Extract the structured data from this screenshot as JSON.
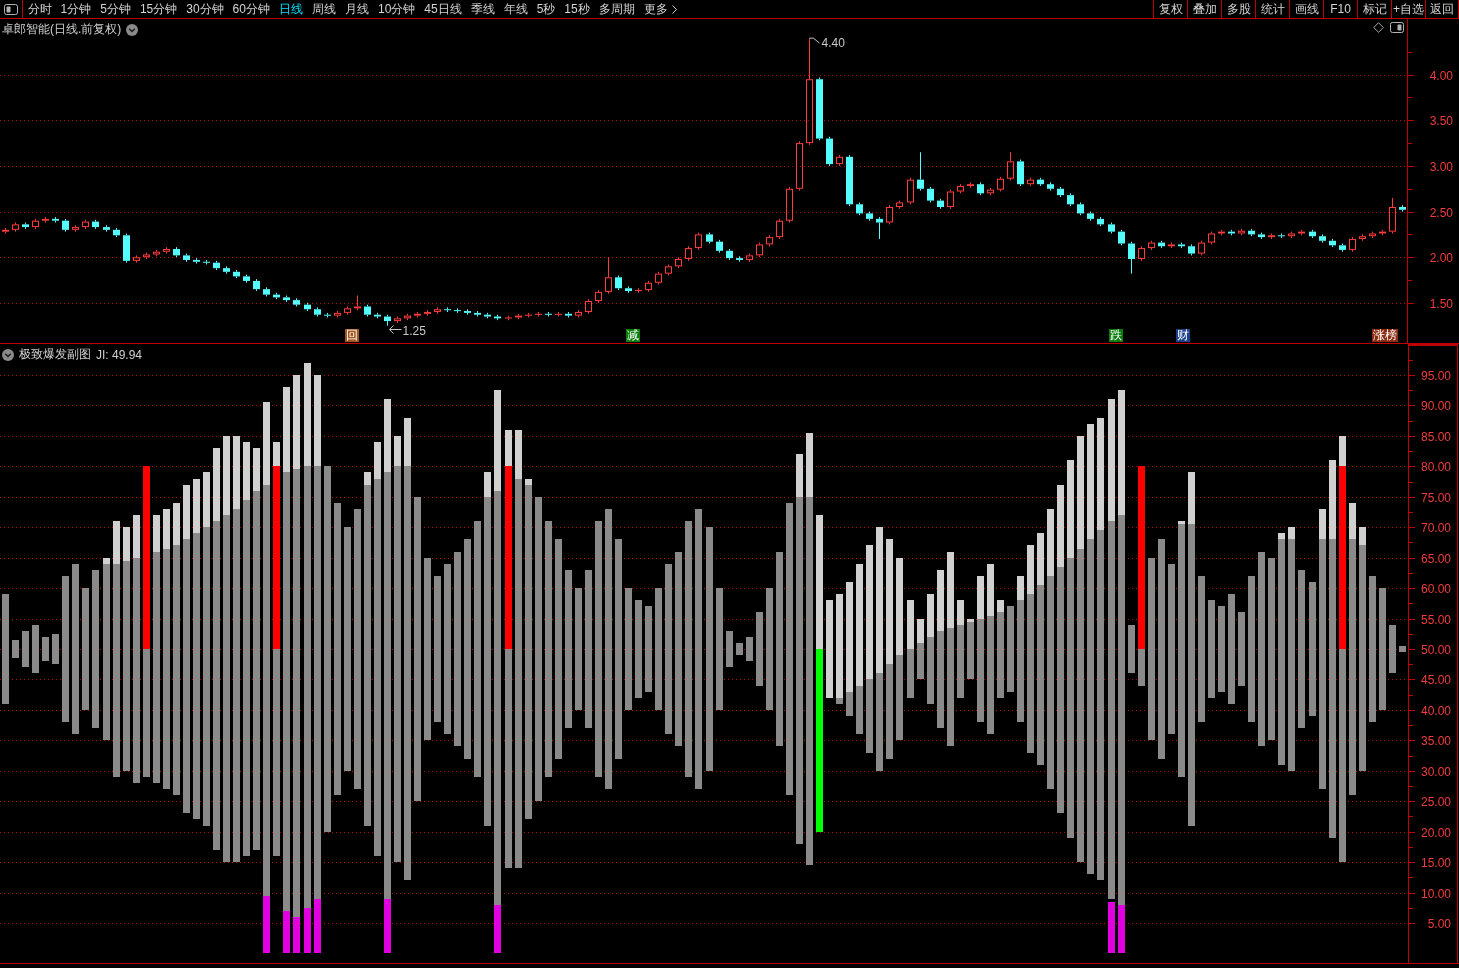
{
  "toolbar": {
    "periods": [
      {
        "label": "分时",
        "selected": false
      },
      {
        "label": "1分钟",
        "selected": false
      },
      {
        "label": "5分钟",
        "selected": false
      },
      {
        "label": "15分钟",
        "selected": false
      },
      {
        "label": "30分钟",
        "selected": false
      },
      {
        "label": "60分钟",
        "selected": false
      },
      {
        "label": "日线",
        "selected": true
      },
      {
        "label": "周线",
        "selected": false
      },
      {
        "label": "月线",
        "selected": false
      },
      {
        "label": "10分钟",
        "selected": false
      },
      {
        "label": "45日线",
        "selected": false
      },
      {
        "label": "季线",
        "selected": false
      },
      {
        "label": "年线",
        "selected": false
      },
      {
        "label": "5秒",
        "selected": false
      },
      {
        "label": "15秒",
        "selected": false
      },
      {
        "label": "多周期",
        "selected": false
      }
    ],
    "more_button": "更多",
    "buttons": [
      "复权",
      "叠加",
      "多股",
      "统计",
      "画线",
      "F10",
      "标记",
      "+自选",
      "返回"
    ]
  },
  "price_panel": {
    "title": "卓郎智能(日线.前复权)",
    "chart_data": {
      "type": "candlestick",
      "grid": true,
      "ylim": [
        1.06,
        4.61
      ],
      "yticks": [
        {
          "value": 1.5,
          "label": "1.50"
        },
        {
          "value": 2.0,
          "label": "2.00"
        },
        {
          "value": 2.5,
          "label": "2.50"
        },
        {
          "value": 3.0,
          "label": "3.00"
        },
        {
          "value": 3.5,
          "label": "3.50"
        },
        {
          "value": 4.0,
          "label": "4.00"
        }
      ],
      "categories": [
        null,
        null,
        null,
        null,
        null,
        null,
        null,
        null,
        null,
        null,
        null,
        null,
        null,
        null,
        null,
        null,
        null,
        null,
        null,
        null,
        null,
        null,
        null,
        null,
        null,
        null,
        null,
        null,
        null,
        null,
        null,
        null,
        null,
        null,
        null,
        null,
        null,
        null,
        null,
        null,
        null,
        null,
        null,
        null,
        null,
        null,
        null,
        null,
        null,
        null,
        null,
        null,
        null,
        null,
        null,
        null,
        null,
        null,
        null,
        null,
        null,
        null,
        null,
        null,
        null,
        null,
        null,
        null,
        null,
        null,
        null,
        null,
        null,
        null,
        null,
        null,
        null,
        null,
        null,
        null,
        null,
        null,
        null,
        null,
        null,
        null,
        null,
        null,
        null,
        null,
        null,
        null,
        null,
        null,
        null,
        null,
        null,
        null,
        null,
        null,
        null,
        null,
        null,
        null,
        null,
        null,
        null,
        null,
        null,
        null,
        null,
        null,
        null,
        null,
        null,
        null,
        null,
        null,
        null,
        null,
        null,
        null,
        null,
        null,
        null,
        null,
        null,
        null,
        null,
        null,
        null,
        null,
        null,
        null,
        null,
        null,
        null,
        null,
        null,
        null
      ],
      "ohlc": [
        [
          2.28,
          2.32,
          2.26,
          2.3
        ],
        [
          2.3,
          2.38,
          2.28,
          2.36
        ],
        [
          2.36,
          2.38,
          2.31,
          2.33
        ],
        [
          2.33,
          2.42,
          2.31,
          2.4
        ],
        [
          2.4,
          2.44,
          2.38,
          2.42
        ],
        [
          2.42,
          2.44,
          2.38,
          2.4
        ],
        [
          2.4,
          2.42,
          2.28,
          2.3
        ],
        [
          2.3,
          2.35,
          2.28,
          2.33
        ],
        [
          2.33,
          2.41,
          2.31,
          2.39
        ],
        [
          2.39,
          2.41,
          2.31,
          2.33
        ],
        [
          2.33,
          2.35,
          2.28,
          2.3
        ],
        [
          2.3,
          2.32,
          2.22,
          2.24
        ],
        [
          2.24,
          2.26,
          1.94,
          1.96
        ],
        [
          1.96,
          2.02,
          1.94,
          2.0
        ],
        [
          2.0,
          2.05,
          1.98,
          2.03
        ],
        [
          2.03,
          2.08,
          2.01,
          2.06
        ],
        [
          2.06,
          2.11,
          2.04,
          2.09
        ],
        [
          2.09,
          2.11,
          2.0,
          2.02
        ],
        [
          2.02,
          2.04,
          1.95,
          1.97
        ],
        [
          1.97,
          1.99,
          1.93,
          1.95
        ],
        [
          1.95,
          1.97,
          1.92,
          1.94
        ],
        [
          1.94,
          1.96,
          1.86,
          1.88
        ],
        [
          1.88,
          1.9,
          1.82,
          1.84
        ],
        [
          1.84,
          1.86,
          1.77,
          1.79
        ],
        [
          1.79,
          1.81,
          1.72,
          1.74
        ],
        [
          1.74,
          1.76,
          1.63,
          1.65
        ],
        [
          1.65,
          1.67,
          1.57,
          1.59
        ],
        [
          1.59,
          1.61,
          1.54,
          1.56
        ],
        [
          1.56,
          1.58,
          1.51,
          1.53
        ],
        [
          1.53,
          1.55,
          1.46,
          1.48
        ],
        [
          1.48,
          1.5,
          1.41,
          1.43
        ],
        [
          1.43,
          1.45,
          1.35,
          1.37
        ],
        [
          1.37,
          1.39,
          1.34,
          1.36
        ],
        [
          1.36,
          1.41,
          1.34,
          1.39
        ],
        [
          1.39,
          1.46,
          1.37,
          1.44
        ],
        [
          1.44,
          1.58,
          1.42,
          1.46
        ],
        [
          1.46,
          1.48,
          1.35,
          1.37
        ],
        [
          1.37,
          1.39,
          1.33,
          1.35
        ],
        [
          1.35,
          1.37,
          1.25,
          1.3
        ],
        [
          1.3,
          1.35,
          1.28,
          1.33
        ],
        [
          1.33,
          1.38,
          1.31,
          1.36
        ],
        [
          1.36,
          1.4,
          1.34,
          1.38
        ],
        [
          1.38,
          1.42,
          1.36,
          1.4
        ],
        [
          1.4,
          1.45,
          1.38,
          1.43
        ],
        [
          1.43,
          1.45,
          1.4,
          1.42
        ],
        [
          1.42,
          1.44,
          1.39,
          1.41
        ],
        [
          1.41,
          1.43,
          1.37,
          1.39
        ],
        [
          1.39,
          1.41,
          1.35,
          1.37
        ],
        [
          1.37,
          1.39,
          1.33,
          1.35
        ],
        [
          1.35,
          1.37,
          1.31,
          1.33
        ],
        [
          1.33,
          1.36,
          1.31,
          1.34
        ],
        [
          1.34,
          1.38,
          1.32,
          1.36
        ],
        [
          1.36,
          1.39,
          1.34,
          1.37
        ],
        [
          1.37,
          1.4,
          1.35,
          1.38
        ],
        [
          1.38,
          1.4,
          1.35,
          1.37
        ],
        [
          1.37,
          1.4,
          1.35,
          1.38
        ],
        [
          1.38,
          1.4,
          1.34,
          1.36
        ],
        [
          1.36,
          1.42,
          1.34,
          1.4
        ],
        [
          1.4,
          1.54,
          1.38,
          1.52
        ],
        [
          1.52,
          1.64,
          1.5,
          1.62
        ],
        [
          1.62,
          2.0,
          1.6,
          1.78
        ],
        [
          1.78,
          1.8,
          1.64,
          1.66
        ],
        [
          1.66,
          1.68,
          1.61,
          1.63
        ],
        [
          1.63,
          1.66,
          1.61,
          1.64
        ],
        [
          1.64,
          1.74,
          1.62,
          1.72
        ],
        [
          1.72,
          1.84,
          1.7,
          1.82
        ],
        [
          1.82,
          1.92,
          1.8,
          1.9
        ],
        [
          1.9,
          2.0,
          1.88,
          1.98
        ],
        [
          1.98,
          2.12,
          1.96,
          2.1
        ],
        [
          2.1,
          2.27,
          2.08,
          2.25
        ],
        [
          2.25,
          2.27,
          2.15,
          2.17
        ],
        [
          2.17,
          2.19,
          2.05,
          2.07
        ],
        [
          2.07,
          2.09,
          1.97,
          1.99
        ],
        [
          1.99,
          2.01,
          1.95,
          1.97
        ],
        [
          1.97,
          2.04,
          1.95,
          2.02
        ],
        [
          2.02,
          2.16,
          2.0,
          2.14
        ],
        [
          2.14,
          2.24,
          2.12,
          2.22
        ],
        [
          2.22,
          2.42,
          2.2,
          2.4
        ],
        [
          2.4,
          2.77,
          2.38,
          2.75
        ],
        [
          2.75,
          3.27,
          2.73,
          3.25
        ],
        [
          3.25,
          4.4,
          3.23,
          3.95
        ],
        [
          3.95,
          3.97,
          3.28,
          3.3
        ],
        [
          3.3,
          3.32,
          3.0,
          3.02
        ],
        [
          3.02,
          3.12,
          3.0,
          3.1
        ],
        [
          3.1,
          3.12,
          2.56,
          2.58
        ],
        [
          2.58,
          2.6,
          2.46,
          2.48
        ],
        [
          2.48,
          2.5,
          2.4,
          2.42
        ],
        [
          2.42,
          2.44,
          2.2,
          2.38
        ],
        [
          2.38,
          2.57,
          2.36,
          2.55
        ],
        [
          2.55,
          2.62,
          2.53,
          2.6
        ],
        [
          2.6,
          2.87,
          2.58,
          2.85
        ],
        [
          2.85,
          3.15,
          2.73,
          2.75
        ],
        [
          2.75,
          2.77,
          2.6,
          2.62
        ],
        [
          2.62,
          2.64,
          2.53,
          2.55
        ],
        [
          2.55,
          2.74,
          2.53,
          2.72
        ],
        [
          2.72,
          2.8,
          2.7,
          2.78
        ],
        [
          2.78,
          2.82,
          2.76,
          2.8
        ],
        [
          2.8,
          2.82,
          2.68,
          2.7
        ],
        [
          2.7,
          2.76,
          2.68,
          2.74
        ],
        [
          2.74,
          2.88,
          2.72,
          2.86
        ],
        [
          2.86,
          3.15,
          2.84,
          3.05
        ],
        [
          3.05,
          3.07,
          2.78,
          2.8
        ],
        [
          2.8,
          2.87,
          2.78,
          2.85
        ],
        [
          2.85,
          2.87,
          2.78,
          2.8
        ],
        [
          2.8,
          2.82,
          2.73,
          2.75
        ],
        [
          2.75,
          2.77,
          2.66,
          2.68
        ],
        [
          2.68,
          2.7,
          2.56,
          2.58
        ],
        [
          2.58,
          2.6,
          2.46,
          2.48
        ],
        [
          2.48,
          2.5,
          2.4,
          2.42
        ],
        [
          2.42,
          2.44,
          2.34,
          2.36
        ],
        [
          2.36,
          2.38,
          2.26,
          2.28
        ],
        [
          2.28,
          2.3,
          2.13,
          2.15
        ],
        [
          2.15,
          2.17,
          1.82,
          1.98
        ],
        [
          1.98,
          2.12,
          1.96,
          2.1
        ],
        [
          2.1,
          2.18,
          2.08,
          2.16
        ],
        [
          2.16,
          2.18,
          2.1,
          2.12
        ],
        [
          2.12,
          2.16,
          2.1,
          2.14
        ],
        [
          2.14,
          2.16,
          2.1,
          2.12
        ],
        [
          2.12,
          2.14,
          2.02,
          2.04
        ],
        [
          2.04,
          2.18,
          2.02,
          2.16
        ],
        [
          2.16,
          2.28,
          2.14,
          2.26
        ],
        [
          2.26,
          2.3,
          2.24,
          2.28
        ],
        [
          2.28,
          2.3,
          2.24,
          2.26
        ],
        [
          2.26,
          2.31,
          2.24,
          2.29
        ],
        [
          2.29,
          2.31,
          2.23,
          2.25
        ],
        [
          2.25,
          2.27,
          2.2,
          2.22
        ],
        [
          2.22,
          2.26,
          2.2,
          2.24
        ],
        [
          2.24,
          2.26,
          2.21,
          2.23
        ],
        [
          2.23,
          2.28,
          2.21,
          2.26
        ],
        [
          2.26,
          2.3,
          2.24,
          2.28
        ],
        [
          2.28,
          2.3,
          2.21,
          2.23
        ],
        [
          2.23,
          2.25,
          2.16,
          2.18
        ],
        [
          2.18,
          2.2,
          2.11,
          2.13
        ],
        [
          2.13,
          2.15,
          2.06,
          2.08
        ],
        [
          2.08,
          2.22,
          2.06,
          2.2
        ],
        [
          2.2,
          2.25,
          2.18,
          2.23
        ],
        [
          2.23,
          2.28,
          2.21,
          2.26
        ],
        [
          2.26,
          2.3,
          2.24,
          2.28
        ],
        [
          2.28,
          2.65,
          2.26,
          2.55
        ],
        [
          2.55,
          2.57,
          2.5,
          2.52
        ]
      ],
      "annotations": [
        "4.40",
        "1.25"
      ]
    },
    "markers": [
      {
        "label": "回",
        "color": "#a0561e"
      },
      {
        "label": "减",
        "color": "#0b7d0b"
      },
      {
        "label": "跌",
        "color": "#0b7d0b"
      },
      {
        "label": "财",
        "color": "#1c3f8c"
      },
      {
        "label": "涨榜",
        "color": "#8a2a10"
      }
    ]
  },
  "indicator_panel": {
    "title": "极致爆发副图",
    "reading": "JI: 49.94",
    "axis_labels": [
      "95.00",
      "90.00",
      "85.00",
      "80.00",
      "75.00",
      "70.00",
      "65.00",
      "60.00",
      "55.00",
      "50.00",
      "45.00",
      "40.00",
      "35.00",
      "30.00",
      "25.00",
      "20.00",
      "15.00",
      "10.00",
      "5.00"
    ]
  }
}
